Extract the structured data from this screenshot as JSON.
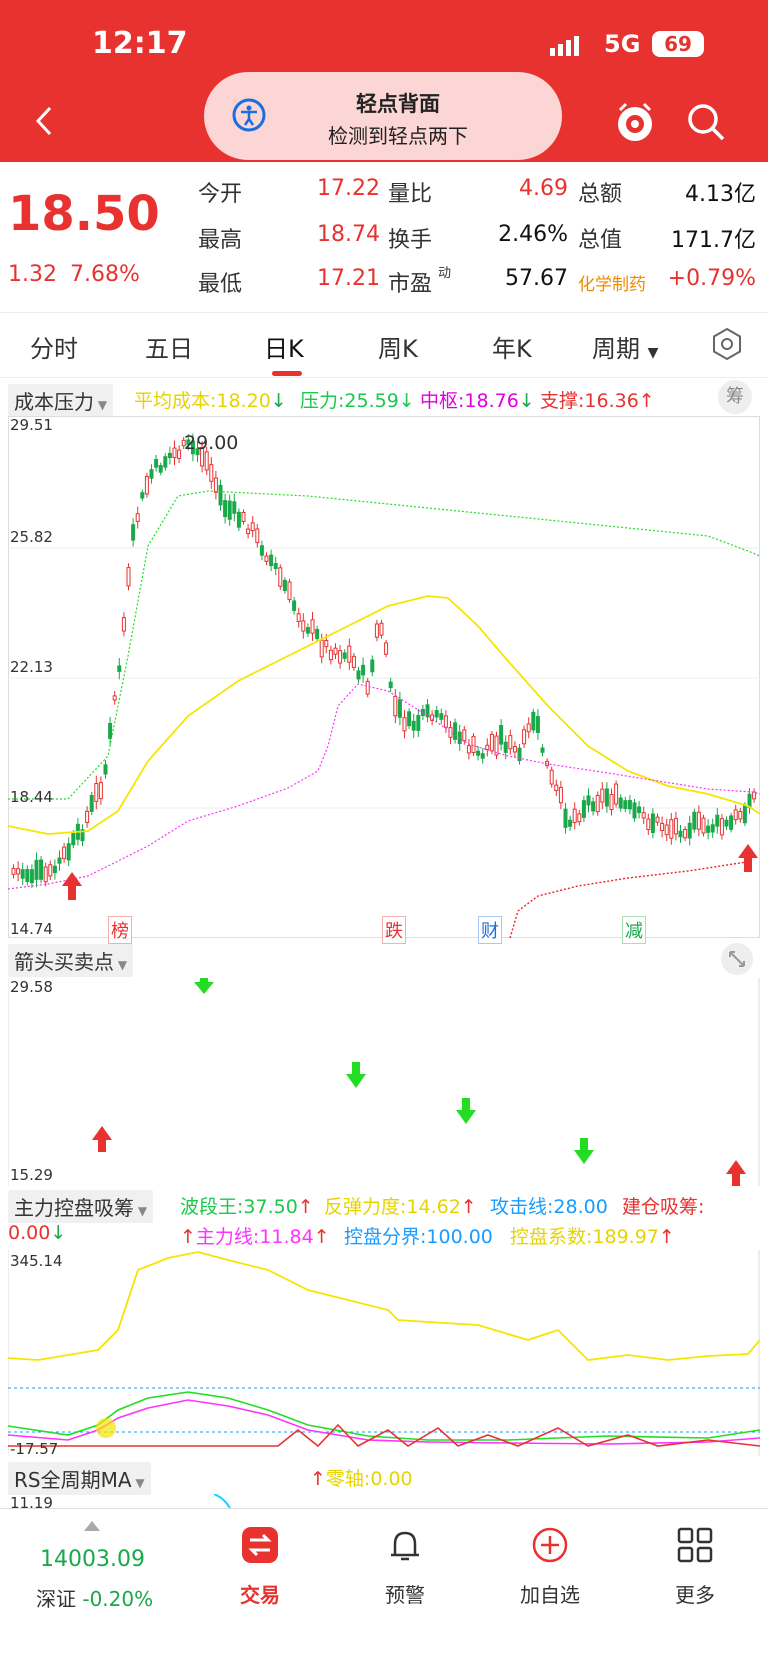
{
  "status": {
    "time": "12:17",
    "network": "5G",
    "battery": "69"
  },
  "pill": {
    "title": "轻点背面",
    "subtitle": "检测到轻点两下"
  },
  "quote": {
    "price": "18.50",
    "change": "1.32",
    "change_pct": "7.68%",
    "rows": [
      {
        "l1": "今开",
        "v1": "17.22",
        "l2": "量比",
        "v2": "4.69",
        "l3": "总额",
        "v3": "4.13亿"
      },
      {
        "l1": "最高",
        "v1": "18.74",
        "l2": "换手",
        "v2": "2.46%",
        "l3": "总值",
        "v3": "171.7亿"
      },
      {
        "l1": "最低",
        "v1": "17.21",
        "l2": "市盈",
        "v2": "57.67",
        "l3": "化学制药",
        "v3": "+0.79%"
      }
    ],
    "pe_sup": "动"
  },
  "tabs": [
    "分时",
    "五日",
    "日K",
    "周K",
    "年K",
    "周期"
  ],
  "cost_panel": {
    "label": "成本压力",
    "chip": "筹",
    "ind_avg": "平均成本:18.20",
    "ind_press": "压力:25.59",
    "ind_mid": "中枢:18.76",
    "ind_support": "支撑:16.36",
    "down_arrow": "↓",
    "up_arrow": "↑",
    "y_top": "29.51",
    "y2": "25.82",
    "y3": "22.13",
    "y4": "18.44",
    "y_bottom": "14.74",
    "peak": "29.00",
    "tags": [
      "榜",
      "跌",
      "财",
      "减"
    ]
  },
  "arrow_panel": {
    "label": "箭头买卖点",
    "y_top": "29.58",
    "y_bottom": "15.29"
  },
  "control_panel": {
    "label": "主力控盘吸筹",
    "i1": "波段王:37.50",
    "i2": "反弹力度:14.62",
    "i3": "攻击线:28.00",
    "i4": "建仓吸筹:",
    "i5": "0.00",
    "i6": "主力线:11.84",
    "i7": "控盘分界:100.00",
    "i8": "控盘系数:189.97",
    "y_top": "345.14",
    "y_bottom": "-17.57"
  },
  "rs_panel": {
    "label": "RS全周期MA",
    "zero": "零轴:0.00",
    "y_top": "11.19"
  },
  "bottom": {
    "index_value": "14003.09",
    "index_name": "深证",
    "index_change": "-0.20%",
    "nav": [
      "交易",
      "预警",
      "加自选",
      "更多"
    ]
  },
  "colors": {
    "red": "#e8322f",
    "green": "#19a84a",
    "yellow": "#f5e600",
    "magenta": "#ff00ff",
    "blue": "#1a9bff"
  }
}
